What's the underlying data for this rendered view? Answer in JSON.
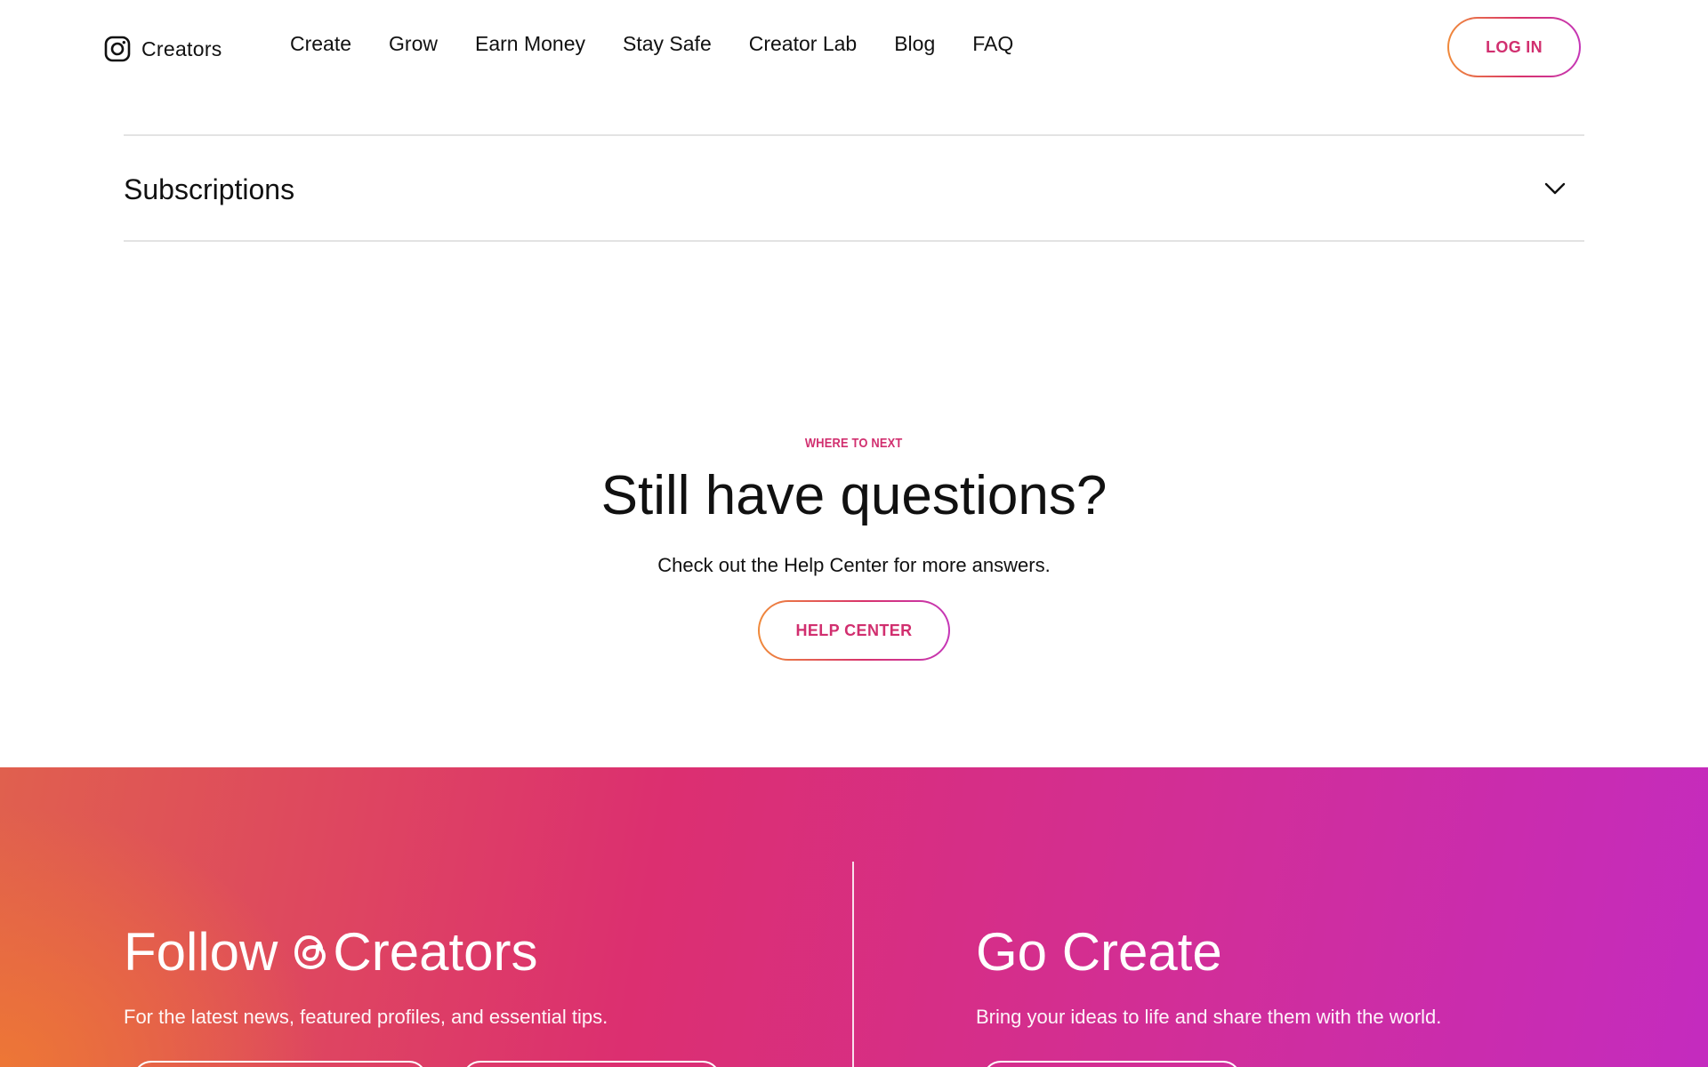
{
  "brand": {
    "logo_icon": "instagram-icon",
    "label": "Creators"
  },
  "nav": {
    "items": [
      "Create",
      "Grow",
      "Earn Money",
      "Stay Safe",
      "Creator Lab",
      "Blog",
      "FAQ"
    ],
    "login_label": "LOG IN"
  },
  "accordion": {
    "title": "Subscriptions",
    "icon": "chevron-down-icon",
    "expanded": false
  },
  "questions": {
    "eyebrow": "WHERE TO NEXT",
    "title": "Still have questions?",
    "subtitle": "Check out the Help Center for more answers.",
    "button_label": "HELP CENTER"
  },
  "promo": {
    "left": {
      "title_prefix": "Follow",
      "title_icon": "threads-icon",
      "title_suffix": "Creators",
      "subtitle": "For the latest news, featured profiles, and essential tips."
    },
    "right": {
      "title": "Go Create",
      "subtitle": "Bring your ideas to life and share them with the world."
    }
  },
  "colors": {
    "accent_text": "#d12f6f",
    "gradient_start": "#f08a3a",
    "gradient_mid": "#dc2f70",
    "gradient_end": "#c42bbf",
    "divider": "#e3e3e3"
  }
}
